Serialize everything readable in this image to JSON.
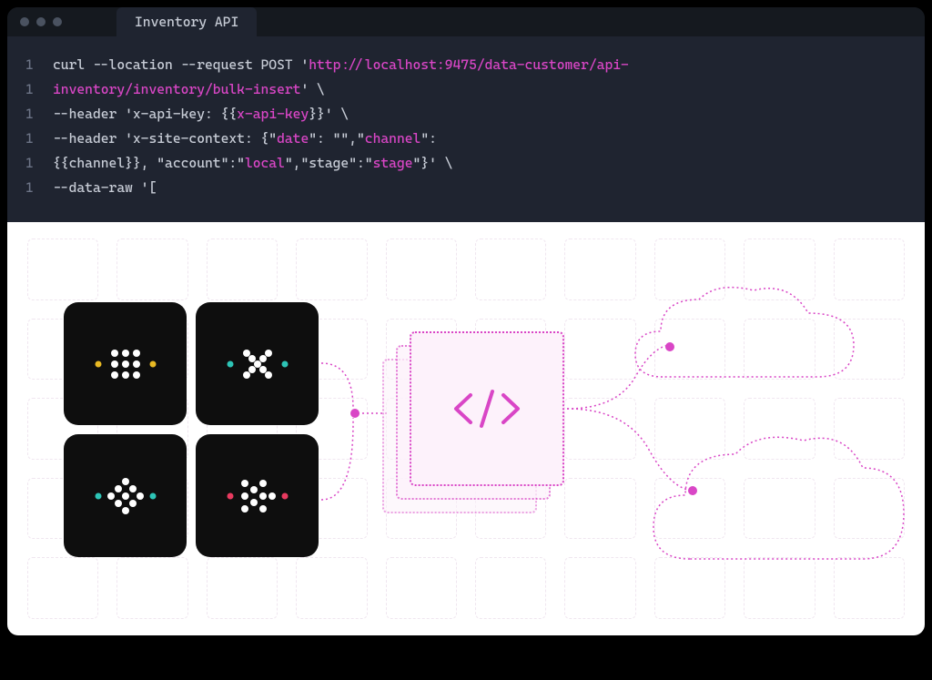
{
  "tab": {
    "title": "Inventory API"
  },
  "code": {
    "lines": [
      {
        "num": "1",
        "segments": [
          {
            "text": "curl --location --request POST '",
            "cls": ""
          },
          {
            "text": "http://localhost:9475/data-customer/api-",
            "cls": "hl-magenta"
          }
        ]
      },
      {
        "num": "1",
        "segments": [
          {
            "text": "inventory/inventory/bulk-insert",
            "cls": "hl-magenta"
          },
          {
            "text": "' \\",
            "cls": ""
          }
        ]
      },
      {
        "num": "1",
        "segments": [
          {
            "text": "--header 'x-api-key: {{",
            "cls": ""
          },
          {
            "text": "x-api-key",
            "cls": "hl-magenta"
          },
          {
            "text": "}}' \\",
            "cls": ""
          }
        ]
      },
      {
        "num": "1",
        "segments": [
          {
            "text": "--header 'x-site-context: {\"",
            "cls": ""
          },
          {
            "text": "date",
            "cls": "hl-magenta"
          },
          {
            "text": "\": \"\",\"",
            "cls": ""
          },
          {
            "text": "channel",
            "cls": "hl-magenta"
          },
          {
            "text": "\":",
            "cls": ""
          }
        ]
      },
      {
        "num": "1",
        "segments": [
          {
            "text": "{{channel}}, \"account\":\"",
            "cls": ""
          },
          {
            "text": "local",
            "cls": "hl-magenta"
          },
          {
            "text": "\",\"stage\":\"",
            "cls": ""
          },
          {
            "text": "stage",
            "cls": "hl-magenta"
          },
          {
            "text": "\"}' \\",
            "cls": ""
          }
        ]
      },
      {
        "num": "1",
        "segments": [
          {
            "text": "--data-raw '[",
            "cls": ""
          }
        ]
      }
    ]
  },
  "diagram": {
    "tiles": [
      "grid-dots",
      "x-pattern",
      "diamond-dots",
      "arrow-dots"
    ],
    "center_icon": "code-brackets",
    "clouds": [
      "cloud-small",
      "cloud-large"
    ]
  },
  "colors": {
    "accent": "#d946c6",
    "tile_accent_yellow": "#e8b923",
    "tile_accent_teal": "#2dc4b6",
    "tile_accent_red": "#e83a5f"
  }
}
